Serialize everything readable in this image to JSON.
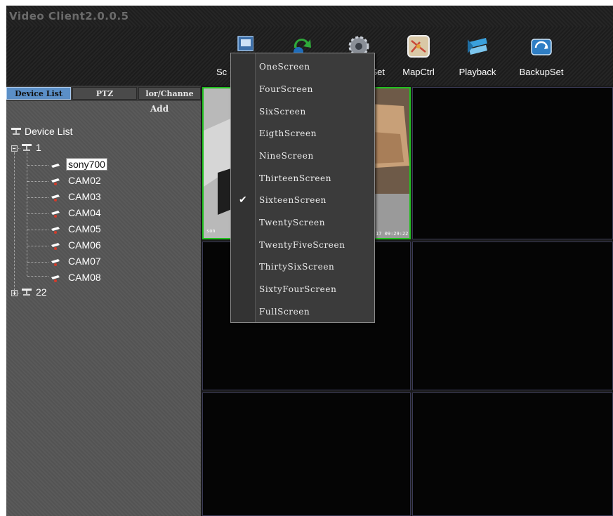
{
  "window": {
    "title": "Video Client2.0.0.5"
  },
  "toolbar": {
    "items": [
      {
        "label": "Sc",
        "icon": "screen-layout-icon"
      },
      {
        "label": "",
        "icon": "refresh-icon"
      },
      {
        "label": "Set",
        "icon": "settings-gear-icon"
      },
      {
        "label": "MapCtrl",
        "icon": "map-icon"
      },
      {
        "label": "Playback",
        "icon": "playback-icon"
      },
      {
        "label": "BackupSet",
        "icon": "backup-icon"
      }
    ]
  },
  "left_panel": {
    "tabs": [
      {
        "label": "Device List",
        "active": true
      },
      {
        "label": "PTZ",
        "active": false
      },
      {
        "label": "lor/Channe",
        "active": false
      }
    ],
    "add_label": "Add",
    "tree": {
      "root_label": "Device List",
      "groups": [
        {
          "label": "1",
          "expanded": true,
          "children": [
            "sony700",
            "CAM02",
            "CAM03",
            "CAM04",
            "CAM05",
            "CAM06",
            "CAM07",
            "CAM08"
          ],
          "selected": "sony700"
        },
        {
          "label": "22",
          "expanded": false
        }
      ]
    }
  },
  "video": {
    "timestamp_left": "son",
    "timestamp_right": "17 09:29:22"
  },
  "screen_menu": {
    "items": [
      {
        "label": "OneScreen",
        "checked": false
      },
      {
        "label": "FourScreen",
        "checked": false
      },
      {
        "label": "SixScreen",
        "checked": false
      },
      {
        "label": "EigthScreen",
        "checked": false
      },
      {
        "label": "NineScreen",
        "checked": false
      },
      {
        "label": "ThirteenScreen",
        "checked": false
      },
      {
        "label": "SixteenScreen",
        "checked": true
      },
      {
        "label": "TwentyScreen",
        "checked": false
      },
      {
        "label": "TwentyFiveScreen",
        "checked": false
      },
      {
        "label": "ThirtySixScreen",
        "checked": false
      },
      {
        "label": "SixtyFourScreen",
        "checked": false
      },
      {
        "label": "FullScreen",
        "checked": false
      }
    ]
  },
  "colors": {
    "active_cell_border": "#22c11f",
    "active_tab": "#5b8fc7",
    "cell_border": "#3a3a55"
  }
}
